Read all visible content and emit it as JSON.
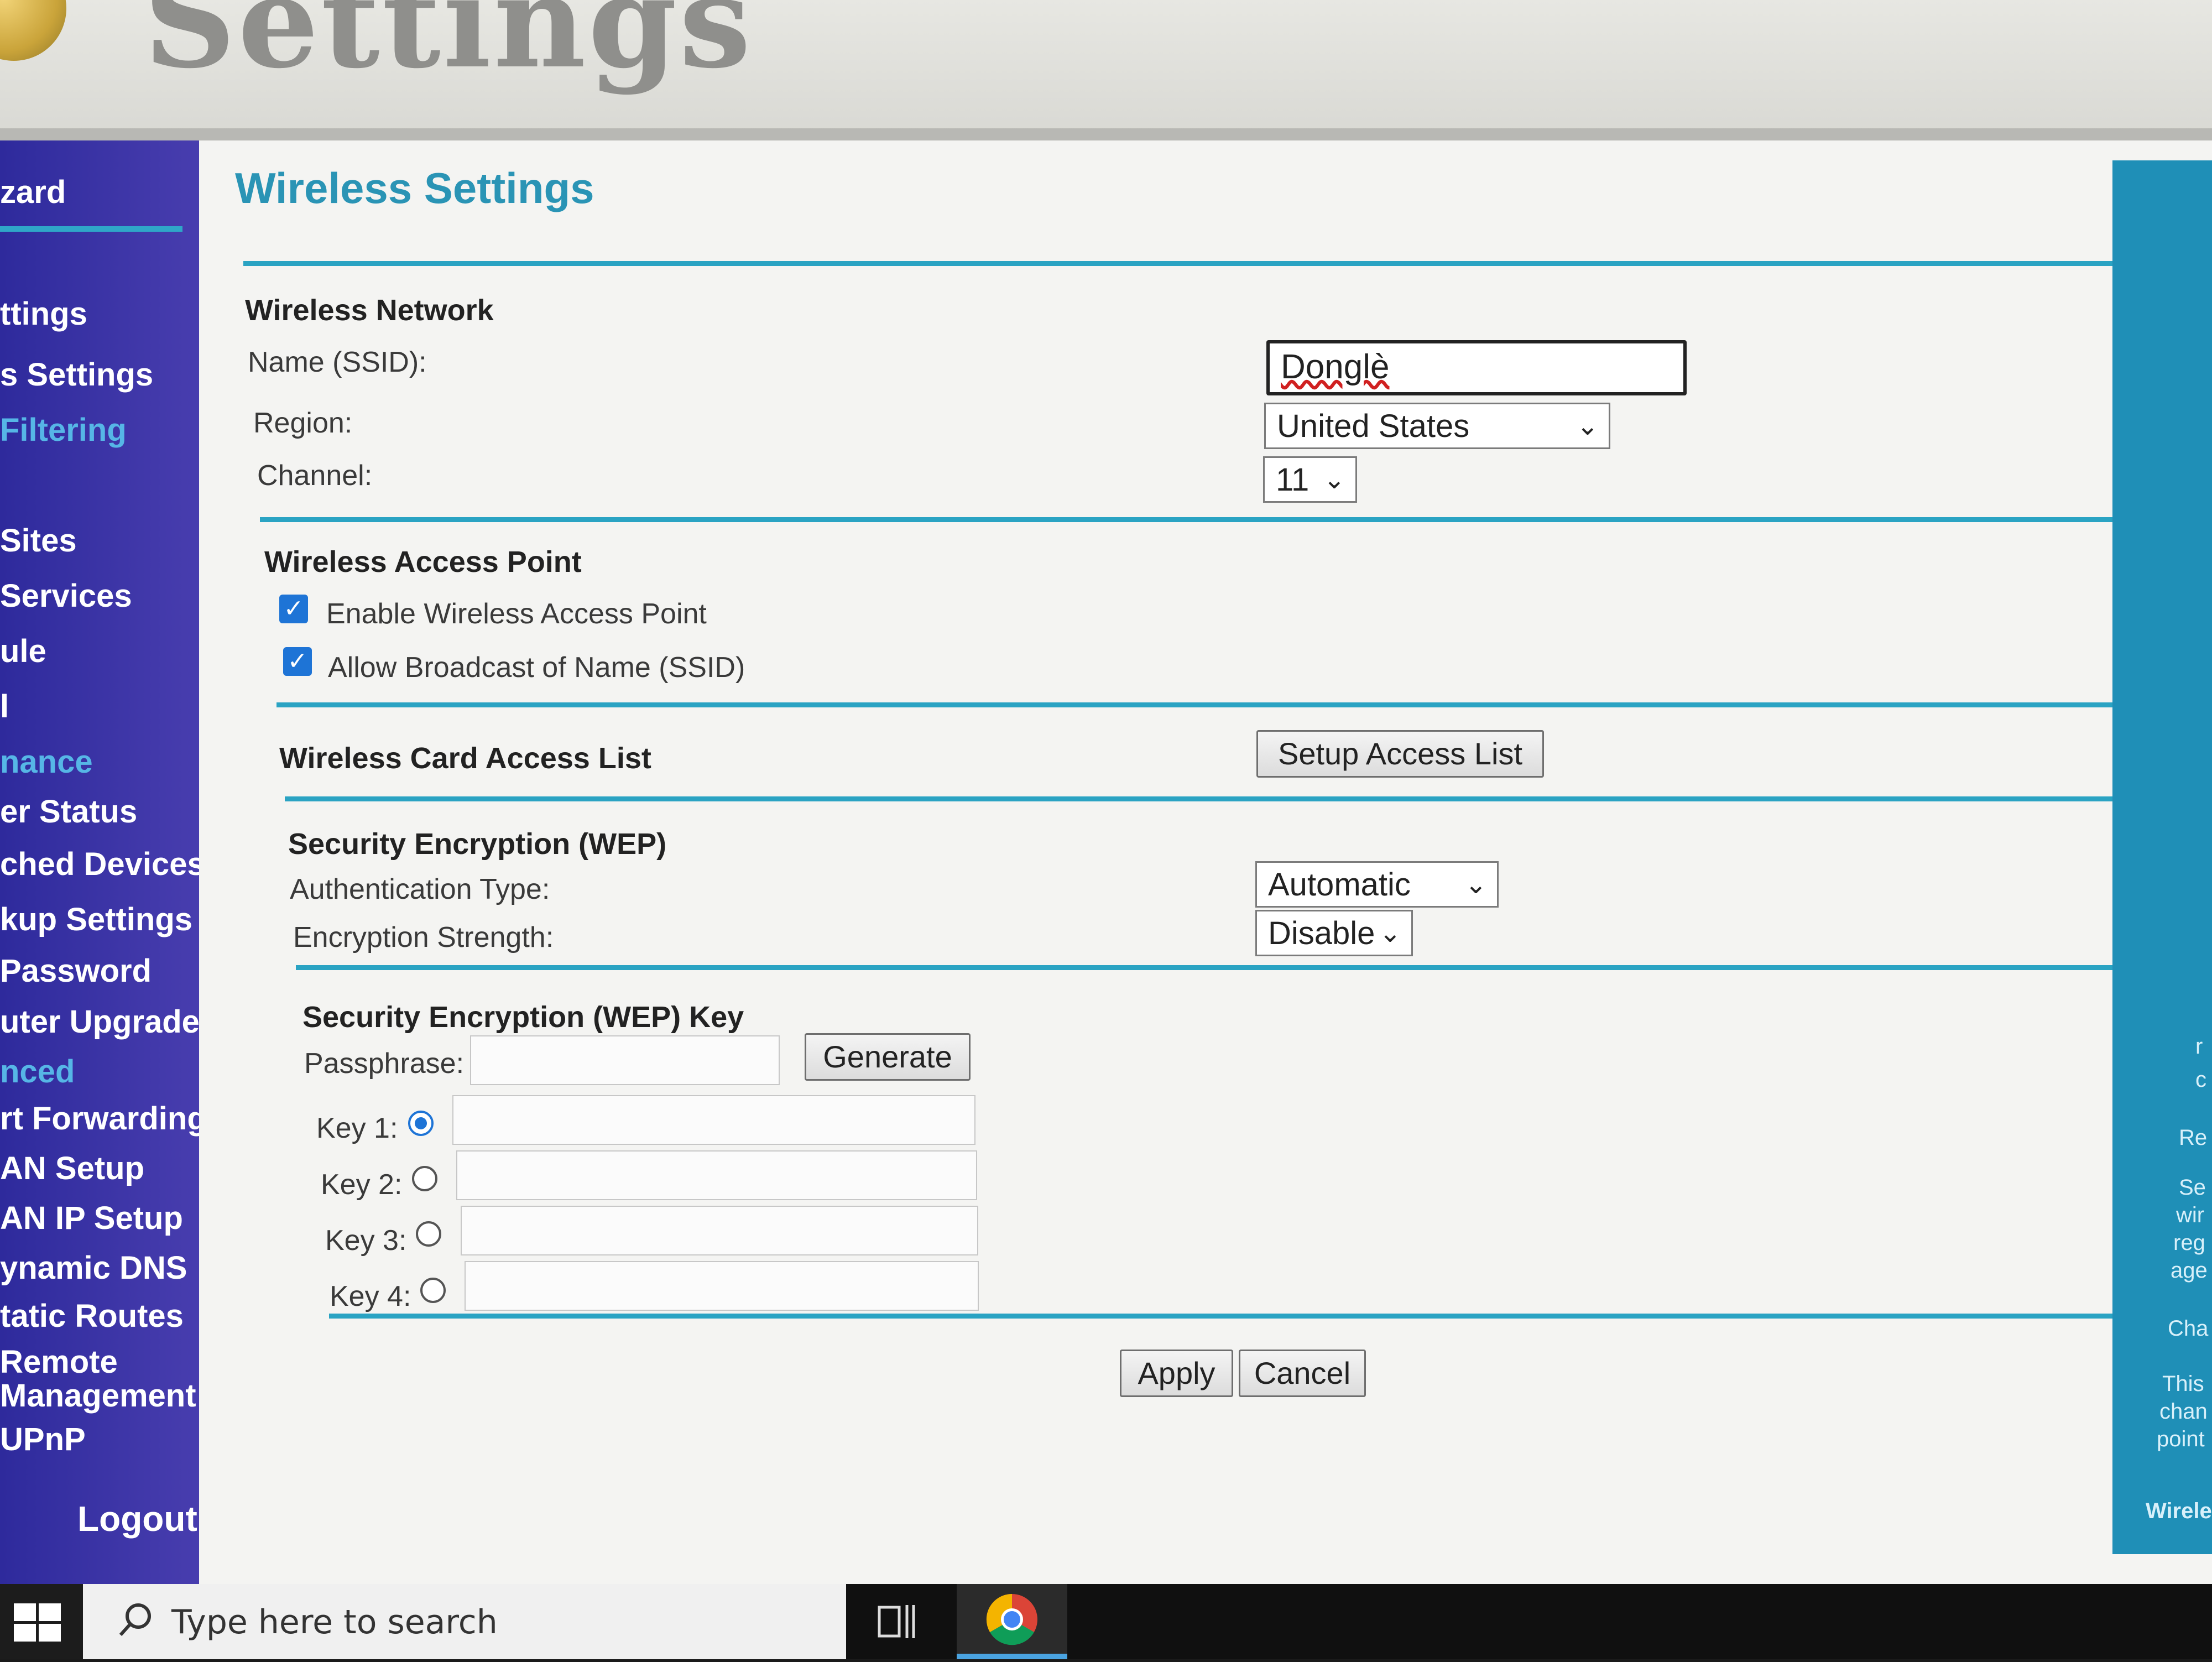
{
  "banner": {
    "title": "Settings"
  },
  "sidebar": {
    "items": [
      {
        "label": "zard",
        "kind": "section-white"
      },
      {
        "label": "ttings",
        "kind": "item"
      },
      {
        "label": "s Settings",
        "kind": "item"
      },
      {
        "label": "Filtering",
        "kind": "section"
      },
      {
        "label": "Sites",
        "kind": "item"
      },
      {
        "label": "Services",
        "kind": "item"
      },
      {
        "label": "ule",
        "kind": "item"
      },
      {
        "label": "l",
        "kind": "item"
      },
      {
        "label": "nance",
        "kind": "section"
      },
      {
        "label": "er Status",
        "kind": "item"
      },
      {
        "label": "ched Devices",
        "kind": "item"
      },
      {
        "label": "kup Settings",
        "kind": "item"
      },
      {
        "label": "Password",
        "kind": "item"
      },
      {
        "label": "uter Upgrade",
        "kind": "item"
      },
      {
        "label": "nced",
        "kind": "section"
      },
      {
        "label": "rt Forwarding",
        "kind": "item"
      },
      {
        "label": "AN Setup",
        "kind": "item"
      },
      {
        "label": "AN IP Setup",
        "kind": "item"
      },
      {
        "label": "ynamic DNS",
        "kind": "item"
      },
      {
        "label": "tatic Routes",
        "kind": "item"
      },
      {
        "label": "Remote",
        "kind": "item"
      },
      {
        "label": "Management",
        "kind": "item"
      },
      {
        "label": "UPnP",
        "kind": "item"
      }
    ],
    "logout": "Logout"
  },
  "main": {
    "title": "Wireless Settings",
    "wireless_network": {
      "heading": "Wireless Network",
      "ssid_label": "Name (SSID):",
      "ssid_value": "Donglè",
      "region_label": "Region:",
      "region_value": "United States",
      "channel_label": "Channel:",
      "channel_value": "11"
    },
    "access_point": {
      "heading": "Wireless Access Point",
      "enable_label": "Enable Wireless Access Point",
      "enable_checked": true,
      "broadcast_label": "Allow Broadcast of Name (SSID)",
      "broadcast_checked": true
    },
    "access_list": {
      "heading": "Wireless Card Access List",
      "button": "Setup Access List"
    },
    "wep": {
      "heading": "Security Encryption (WEP)",
      "auth_label": "Authentication Type:",
      "auth_value": "Automatic",
      "strength_label": "Encryption Strength:",
      "strength_value": "Disable"
    },
    "wep_key": {
      "heading": "Security Encryption (WEP) Key",
      "passphrase_label": "Passphrase:",
      "generate_button": "Generate",
      "keys": [
        {
          "label": "Key 1:",
          "selected": true
        },
        {
          "label": "Key 2:",
          "selected": false
        },
        {
          "label": "Key 3:",
          "selected": false
        },
        {
          "label": "Key 4:",
          "selected": false
        }
      ]
    },
    "actions": {
      "apply": "Apply",
      "cancel": "Cancel"
    }
  },
  "help": {
    "lines": [
      "r",
      "c",
      "Re",
      "Se",
      "wir",
      "reg",
      "age",
      "Cha",
      "This",
      "chan",
      "point",
      "Wirele"
    ]
  },
  "taskbar": {
    "search_placeholder": "Type here to search"
  },
  "colors": {
    "sidebar": "#3b34a8",
    "accent": "#2aa3c3",
    "title": "#2a94b5"
  }
}
